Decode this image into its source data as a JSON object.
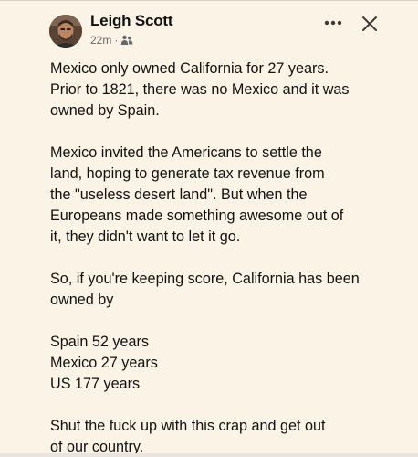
{
  "post": {
    "author": "Leigh Scott",
    "timestamp": "22m",
    "separator": "·",
    "audience_icon": "friends-icon",
    "more_icon": "more-options-icon",
    "close_icon": "close-icon",
    "paragraphs": [
      "Mexico only owned California for 27 years.\nPrior to 1821, there was no Mexico and it was\nowned by Spain.",
      "Mexico invited the Americans to settle the\nland, hoping to generate tax revenue from\nthe \"useless desert land\". But when the\nEuropeans made something awesome out of\nit, they didn't want to let it go.",
      "So, if you're keeping score, California has been\nowned by",
      "Spain 52 years\nMexico 27 years\nUS 177 years",
      "Shut the fuck up with this crap and get out\nof our country."
    ]
  },
  "colors": {
    "background": "#fbf4e6",
    "text": "#111111",
    "meta_text": "#65676b"
  }
}
